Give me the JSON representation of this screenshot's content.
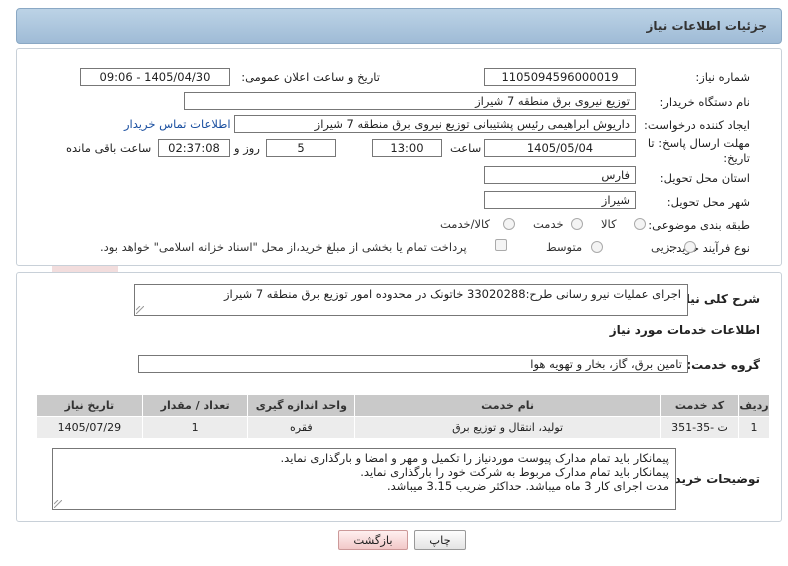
{
  "header": {
    "title": "جزئیات اطلاعات نیاز"
  },
  "fields": {
    "need_number_label": "شماره نیاز:",
    "need_number": "1105094596000019",
    "announce_label": "تاریخ و ساعت اعلان عمومی:",
    "announce_value": "1405/04/30 - 09:06",
    "buyer_org_label": "نام دستگاه خریدار:",
    "buyer_org": "توزیع نیروی برق منطقه 7 شیراز",
    "creator_label": "ایجاد کننده درخواست:",
    "creator": "داریوش ابراهیمی رئیس پشتیبانی توزیع نیروی برق منطقه 7 شیراز",
    "contact_link": "اطلاعات تماس خریدار",
    "deadline_label_1": "مهلت ارسال پاسخ: تا",
    "deadline_label_2": "تاریخ:",
    "deadline_date": "1405/05/04",
    "time_label": "ساعت",
    "deadline_time": "13:00",
    "days_value": "5",
    "days_label": "روز و",
    "remaining_time": "02:37:08",
    "remaining_label": "ساعت باقی مانده",
    "province_label": "استان محل تحویل:",
    "province": "فارس",
    "city_label": "شهر محل تحویل:",
    "city": "شیراز",
    "category_label": "طبقه بندی موضوعی:",
    "category_options": [
      "کالا",
      "خدمت",
      "کالا/خدمت"
    ],
    "process_label": "نوع فرآیند خرید :",
    "process_options": [
      "جزیی",
      "متوسط"
    ],
    "payment_note": "پرداخت تمام یا بخشی از مبلغ خرید،از محل \"اسناد خزانه اسلامی\" خواهد بود."
  },
  "summary": {
    "label": "شرح کلی نیاز:",
    "text": "اجرای عملیات نیرو رسانی طرح:33020288 خاتونک در محدوده امور توزیع برق منطقه 7 شیراز"
  },
  "services": {
    "section_title": "اطلاعات خدمات مورد نیاز",
    "group_label": "گروه خدمت:",
    "group_value": "تامین برق، گاز، بخار و تهویه هوا",
    "columns": [
      "ردیف",
      "کد خدمت",
      "نام خدمت",
      "واحد اندازه گیری",
      "تعداد / مقدار",
      "تاریخ نیاز"
    ],
    "rows": [
      [
        "1",
        "ت -35-351",
        "تولید، انتقال و توزیع برق",
        "فقره",
        "1",
        "1405/07/29"
      ]
    ]
  },
  "buyer_notes": {
    "label": "توضیحات خریدار:",
    "lines": [
      "پیمانکار باید تمام مدارک پیوست موردنیاز را تکمیل و مهر و امضا و بارگذاری نماید.",
      "پیمانکار باید تمام مدارک مربوط به شرکت خود را بارگذاری نماید.",
      "مدت اجرای کار 3 ماه میباشد. حداکثر ضریب 3.15 میباشد."
    ]
  },
  "buttons": {
    "print": "چاپ",
    "back": "بازگشت"
  },
  "colors": {
    "header": "#a9c3dc",
    "link": "#1a4fa0",
    "table_head": "#c9c9c9"
  }
}
